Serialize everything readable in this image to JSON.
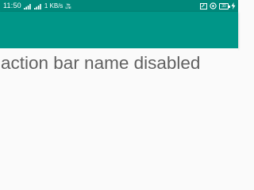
{
  "status_bar": {
    "time": "11:50",
    "network_speed": "1 KB/s",
    "volte_line1": "Vo",
    "volte_line2": "LTE",
    "battery_level": "30",
    "bar_color": "#00897b"
  },
  "action_bar": {
    "color": "#009688"
  },
  "content": {
    "text": "action bar name disabled",
    "text_color": "#616161"
  }
}
